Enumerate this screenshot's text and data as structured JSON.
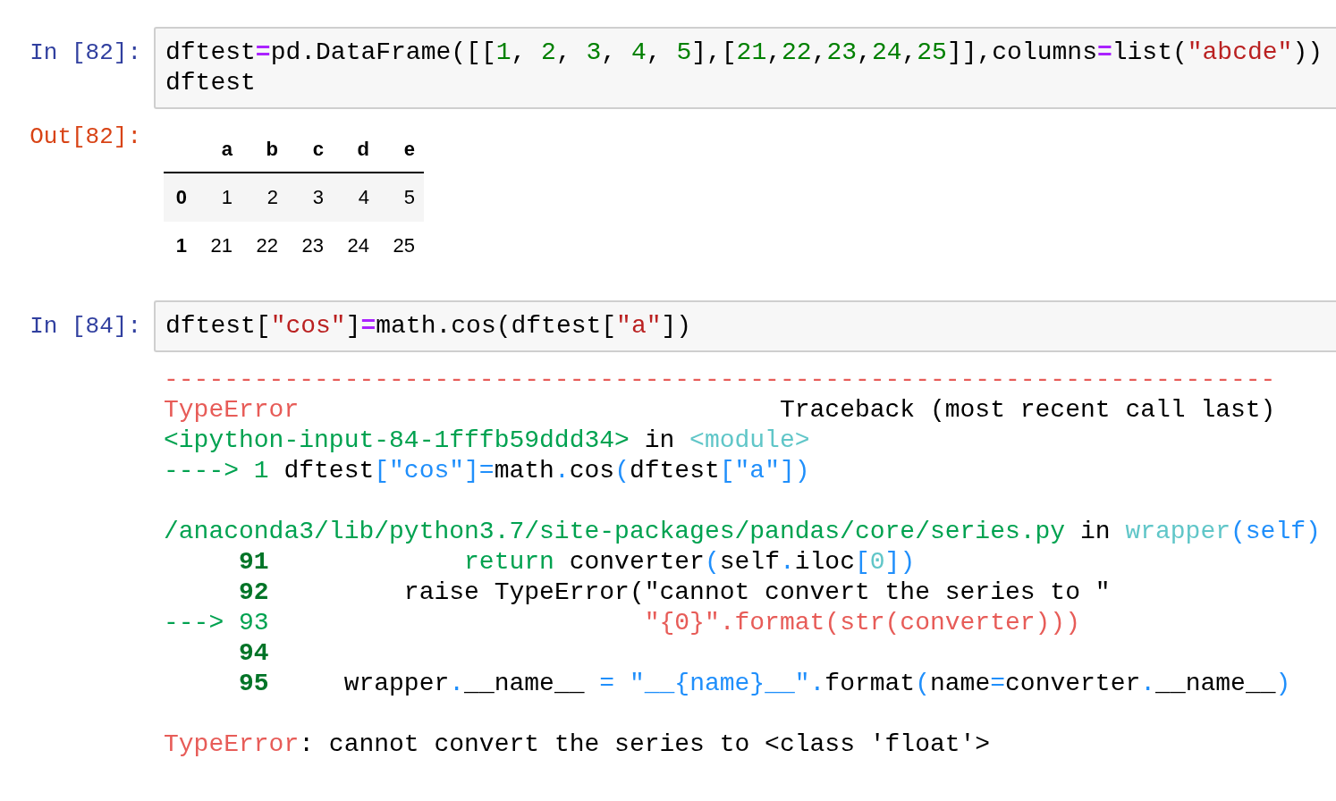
{
  "cells": [
    {
      "prompt": "In [82]:",
      "lines": [
        {
          "kind": "code",
          "tokens": [
            {
              "kind": "plain",
              "text": "dftest"
            },
            {
              "kind": "op",
              "text": "="
            },
            {
              "kind": "plain",
              "text": "pd.DataFrame([["
            },
            {
              "kind": "num",
              "text": "1"
            },
            {
              "kind": "plain",
              "text": ", "
            },
            {
              "kind": "num",
              "text": "2"
            },
            {
              "kind": "plain",
              "text": ", "
            },
            {
              "kind": "num",
              "text": "3"
            },
            {
              "kind": "plain",
              "text": ", "
            },
            {
              "kind": "num",
              "text": "4"
            },
            {
              "kind": "plain",
              "text": ", "
            },
            {
              "kind": "num",
              "text": "5"
            },
            {
              "kind": "plain",
              "text": "],["
            },
            {
              "kind": "num",
              "text": "21"
            },
            {
              "kind": "plain",
              "text": ","
            },
            {
              "kind": "num",
              "text": "22"
            },
            {
              "kind": "plain",
              "text": ","
            },
            {
              "kind": "num",
              "text": "23"
            },
            {
              "kind": "plain",
              "text": ","
            },
            {
              "kind": "num",
              "text": "24"
            },
            {
              "kind": "plain",
              "text": ","
            },
            {
              "kind": "num",
              "text": "25"
            },
            {
              "kind": "plain",
              "text": "]],columns"
            },
            {
              "kind": "op",
              "text": "="
            },
            {
              "kind": "plain",
              "text": "list("
            },
            {
              "kind": "str",
              "text": "\"abcde\""
            },
            {
              "kind": "plain",
              "text": "))"
            }
          ]
        },
        {
          "kind": "code",
          "tokens": [
            {
              "kind": "plain",
              "text": "dftest"
            }
          ]
        }
      ],
      "output": {
        "kind": "table",
        "prompt": "Out[82]:",
        "columns": [
          "a",
          "b",
          "c",
          "d",
          "e"
        ],
        "rows": [
          {
            "index": "0",
            "values": [
              "1",
              "2",
              "3",
              "4",
              "5"
            ]
          },
          {
            "index": "1",
            "values": [
              "21",
              "22",
              "23",
              "24",
              "25"
            ]
          }
        ]
      }
    },
    {
      "prompt": "In [84]:",
      "lines": [
        {
          "kind": "code",
          "tokens": [
            {
              "kind": "plain",
              "text": "dftest["
            },
            {
              "kind": "str",
              "text": "\"cos\""
            },
            {
              "kind": "plain",
              "text": "]"
            },
            {
              "kind": "op",
              "text": "="
            },
            {
              "kind": "plain",
              "text": "math.cos(dftest["
            },
            {
              "kind": "str",
              "text": "\"a\""
            },
            {
              "kind": "plain",
              "text": "])"
            }
          ]
        }
      ],
      "output": {
        "kind": "traceback",
        "lines": [
          {
            "kind": "code",
            "tokens": [
              {
                "kind": "err",
                "text": "--------------------------------------------------------------------------"
              }
            ]
          },
          {
            "kind": "code",
            "tokens": [
              {
                "kind": "err",
                "text": "TypeError"
              },
              {
                "kind": "plain",
                "text": "                                Traceback (most recent call last)"
              }
            ]
          },
          {
            "kind": "code",
            "tokens": [
              {
                "kind": "path",
                "text": "<ipython-input-84-1fffb59ddd34>"
              },
              {
                "kind": "plain",
                "text": " in "
              },
              {
                "kind": "cyan",
                "text": "<module>"
              }
            ]
          },
          {
            "kind": "code",
            "tokens": [
              {
                "kind": "path",
                "text": "----> 1 "
              },
              {
                "kind": "plain",
                "text": "dftest"
              },
              {
                "kind": "blue",
                "text": "[\"cos\"]="
              },
              {
                "kind": "plain",
                "text": "math"
              },
              {
                "kind": "blue",
                "text": "."
              },
              {
                "kind": "plain",
                "text": "cos"
              },
              {
                "kind": "blue",
                "text": "("
              },
              {
                "kind": "plain",
                "text": "dftest"
              },
              {
                "kind": "blue",
                "text": "[\"a\"])"
              }
            ]
          },
          {
            "kind": "blank"
          },
          {
            "kind": "code",
            "tokens": [
              {
                "kind": "path",
                "text": "/anaconda3/lib/python3.7/site-packages/pandas/core/series.py"
              },
              {
                "kind": "plain",
                "text": " in "
              },
              {
                "kind": "cyan",
                "text": "wrapper"
              },
              {
                "kind": "blue",
                "text": "(self)"
              }
            ]
          },
          {
            "kind": "code",
            "tokens": [
              {
                "kind": "lineno",
                "text": "     91"
              },
              {
                "kind": "path",
                "text": "             return"
              },
              {
                "kind": "plain",
                "text": " converter"
              },
              {
                "kind": "blue",
                "text": "("
              },
              {
                "kind": "plain",
                "text": "self"
              },
              {
                "kind": "blue",
                "text": "."
              },
              {
                "kind": "plain",
                "text": "iloc"
              },
              {
                "kind": "blue",
                "text": "["
              },
              {
                "kind": "cyan",
                "text": "0"
              },
              {
                "kind": "blue",
                "text": "])"
              }
            ]
          },
          {
            "kind": "code",
            "tokens": [
              {
                "kind": "lineno",
                "text": "     92"
              },
              {
                "kind": "plain",
                "text": "         raise TypeError(\"cannot convert the series to \""
              }
            ]
          },
          {
            "kind": "code",
            "tokens": [
              {
                "kind": "path",
                "text": "---> 93"
              },
              {
                "kind": "err",
                "text": "                         \"{0}\".format(str(converter)))"
              }
            ]
          },
          {
            "kind": "code",
            "tokens": [
              {
                "kind": "lineno",
                "text": "     94"
              }
            ]
          },
          {
            "kind": "code",
            "tokens": [
              {
                "kind": "lineno",
                "text": "     95"
              },
              {
                "kind": "plain",
                "text": "     wrapper"
              },
              {
                "kind": "blue",
                "text": "."
              },
              {
                "kind": "plain",
                "text": "__name__ "
              },
              {
                "kind": "blue",
                "text": "= \"__{name}__\"."
              },
              {
                "kind": "plain",
                "text": "format"
              },
              {
                "kind": "blue",
                "text": "("
              },
              {
                "kind": "plain",
                "text": "name"
              },
              {
                "kind": "blue",
                "text": "="
              },
              {
                "kind": "plain",
                "text": "converter"
              },
              {
                "kind": "blue",
                "text": "."
              },
              {
                "kind": "plain",
                "text": "__name__"
              },
              {
                "kind": "blue",
                "text": ")"
              }
            ]
          },
          {
            "kind": "blank"
          },
          {
            "kind": "code",
            "tokens": [
              {
                "kind": "err",
                "text": "TypeError"
              },
              {
                "kind": "plain",
                "text": ": cannot convert the series to <class 'float'>"
              }
            ]
          }
        ]
      }
    }
  ]
}
